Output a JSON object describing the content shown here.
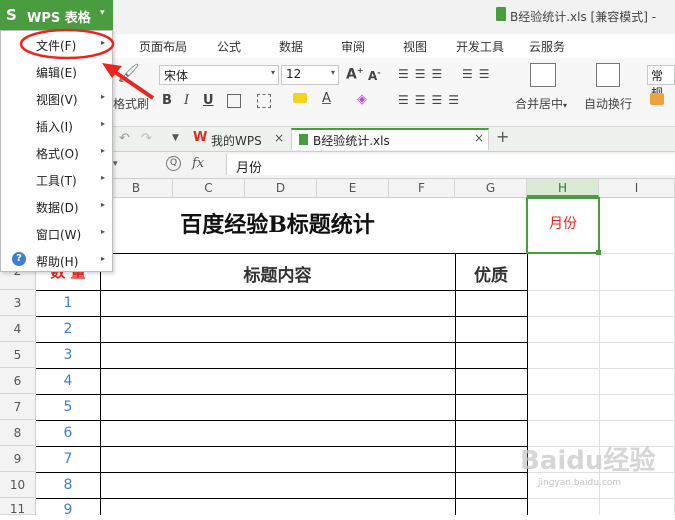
{
  "app": {
    "logo_letter": "S",
    "name": "WPS 表格",
    "dropdown_arrow": "▾"
  },
  "document_title": "B经验统计.xls [兼容模式] -",
  "menu_tabs": [
    "页面布局",
    "公式",
    "数据",
    "审阅",
    "视图",
    "开发工具",
    "云服务"
  ],
  "ribbon": {
    "format_painter": "格式刷",
    "font_name": "宋体",
    "font_size": "12",
    "bold": "B",
    "italic": "I",
    "underline": "U",
    "merge_center": "合并居中",
    "merge_arrow": "▾",
    "wrap_text": "自动换行",
    "number_format": "常规",
    "grow_font": "A",
    "shrink_font": "A"
  },
  "doc_tabs": {
    "home_tab": "我的WPS",
    "file_tab": "B经验统计.xls",
    "close": "×",
    "add": "+"
  },
  "formula_bar": {
    "fx": "fx",
    "content": "月份"
  },
  "columns": [
    "B",
    "C",
    "D",
    "E",
    "F",
    "G",
    "H",
    "I"
  ],
  "rows": [
    "2",
    "3",
    "4",
    "5",
    "6",
    "7",
    "8",
    "9",
    "10",
    "11"
  ],
  "sheet": {
    "title": "百度经验B标题统计",
    "selected_cell": "月份",
    "header_qty": "数 量",
    "header_content": "标题内容",
    "header_quality": "优质",
    "numbers": [
      "1",
      "2",
      "3",
      "4",
      "5",
      "6",
      "7",
      "8",
      "9"
    ]
  },
  "app_menu": {
    "items": [
      {
        "label": "文件(F)"
      },
      {
        "label": "编辑(E)"
      },
      {
        "label": "视图(V)"
      },
      {
        "label": "插入(I)"
      },
      {
        "label": "格式(O)"
      },
      {
        "label": "工具(T)"
      },
      {
        "label": "数据(D)"
      },
      {
        "label": "窗口(W)"
      },
      {
        "label": "帮助(H)"
      }
    ],
    "submenu_arrow": "▸"
  },
  "watermark": {
    "text": "Baidu经验",
    "sub": "jingyan.baidu.com"
  },
  "colors": {
    "wps_green": "#4a9d3e",
    "accent_red": "#e8261f",
    "number_blue": "#3d7fd6",
    "selection_green": "#4a9d3e"
  }
}
